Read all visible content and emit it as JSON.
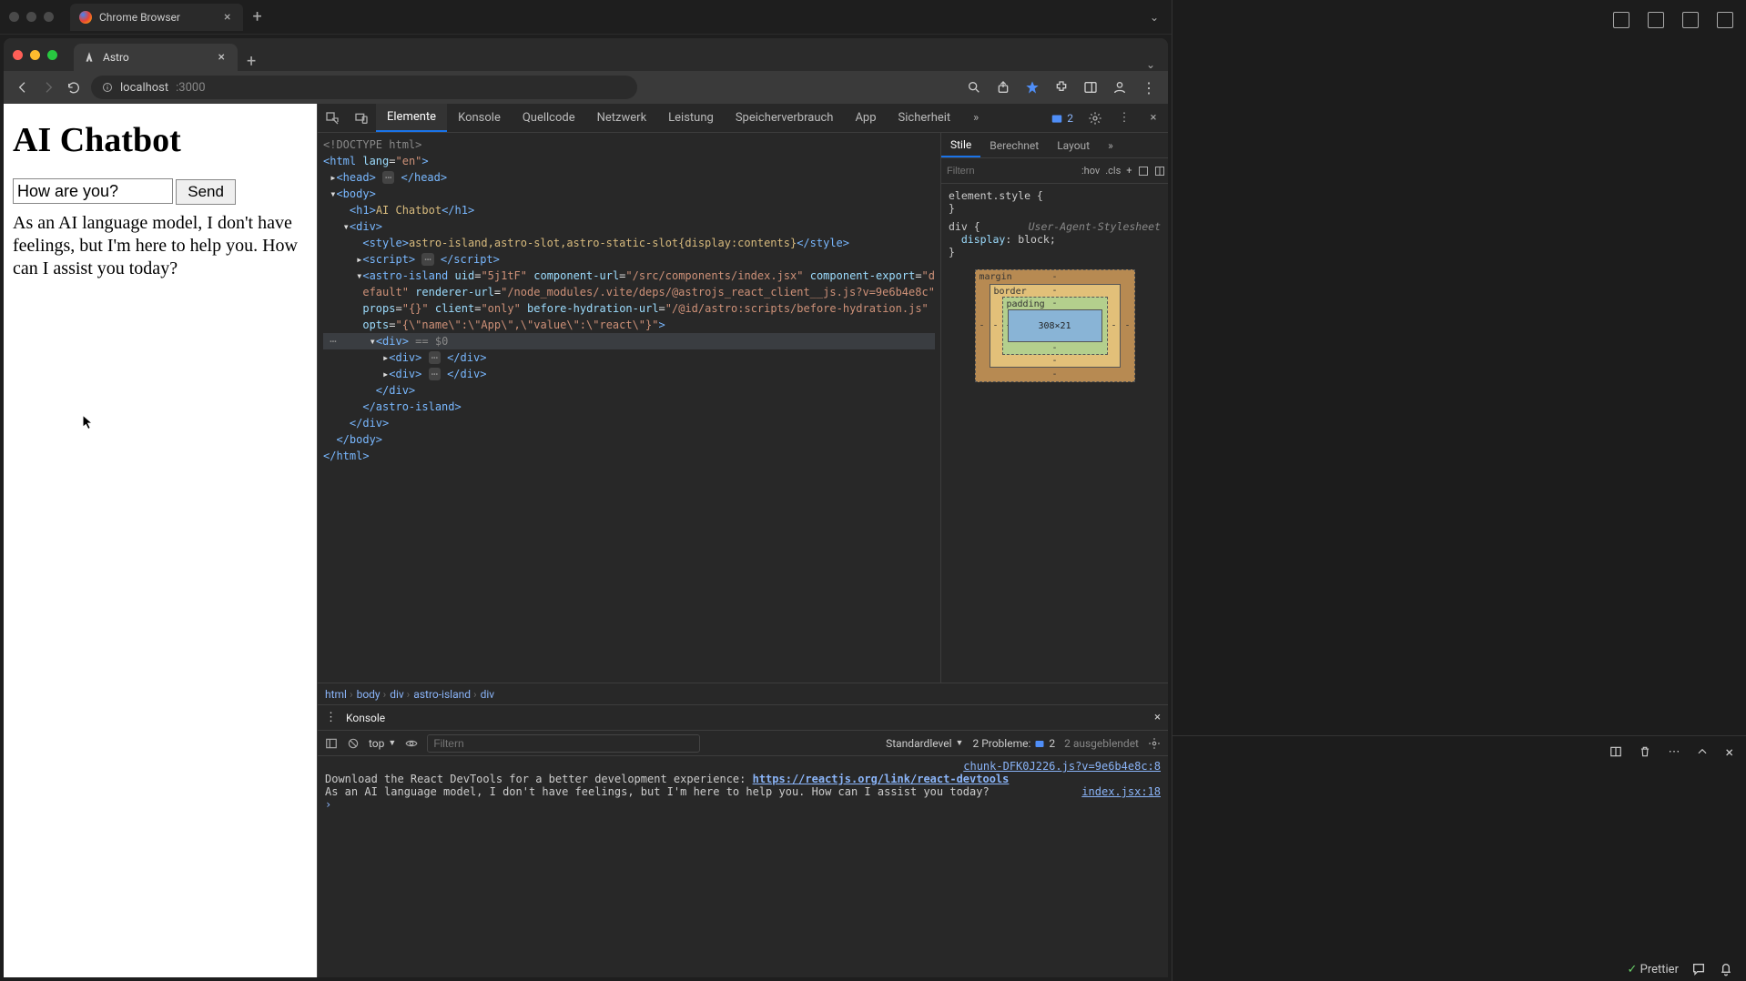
{
  "outer_window": {
    "tab_title": "Chrome Browser"
  },
  "browser": {
    "tab_title": "Astro",
    "address_host": "localhost",
    "address_rest": ":3000"
  },
  "page": {
    "heading": "AI Chatbot",
    "input_value": "How are you?",
    "send_label": "Send",
    "response_text": "As an AI language model, I don't have feelings, but I'm here to help you. How can I assist you today?"
  },
  "devtools": {
    "tabs": [
      "Elemente",
      "Konsole",
      "Quellcode",
      "Netzwerk",
      "Leistung",
      "Speicherverbrauch",
      "App",
      "Sicherheit"
    ],
    "active_tab": "Elemente",
    "issues_count": "2",
    "styles_tabs": [
      "Stile",
      "Berechnet",
      "Layout"
    ],
    "styles_active": "Stile",
    "filter_placeholder": "Filtern",
    "hov_label": ":hov",
    "cls_label": ".cls",
    "element_style_label": "element.style {",
    "close_brace": "}",
    "rule_selector": "div {",
    "rule_source": "User-Agent-Stylesheet",
    "rule_decl_prop": "display",
    "rule_decl_val": "block",
    "box": {
      "margin_label": "margin",
      "border_label": "border",
      "padding_label": "padding",
      "content_dims": "308×21"
    },
    "breadcrumb": [
      "html",
      "body",
      "div",
      "astro-island",
      "div"
    ]
  },
  "dom": {
    "l0": "<!DOCTYPE html>",
    "l1_open": "<html ",
    "l1_attr_n": "lang",
    "l1_attr_v": "\"en\"",
    "l1_close": ">",
    "l2": "<head>",
    "l2b": "</head>",
    "l3": "<body>",
    "l4": "<h1>",
    "l4t": "AI Chatbot",
    "l4c": "</h1>",
    "l5": "<div>",
    "l6": "<style>",
    "l6t": "astro-island,astro-slot,astro-static-slot{display:contents}",
    "l6c": "</style>",
    "l7": "<script>",
    "l7c": "</script>",
    "l8a": "<astro-island ",
    "l8_uid_n": "uid",
    "l8_uid_v": "\"5j1tF\"",
    "l8_cu_n": "component-url",
    "l8_cu_v": "\"/src/components/index.jsx\"",
    "l8_ce_n": "component-export",
    "l8_ce_v": "\"default\"",
    "l8_ru_n": "renderer-url",
    "l8_ru_v": "\"/node_modules/.vite/deps/@astrojs_react_client__js.js?v=9e6b4e8c\"",
    "l8_pr_n": "props",
    "l8_pr_v": "\"{}\"",
    "l8_cl_n": "client",
    "l8_cl_v": "\"only\"",
    "l8_bh_n": "before-hydration-url",
    "l8_bh_v": "\"/@id/astro:scripts/before-hydration.js\"",
    "l8_op_n": "opts",
    "l8_op_v": "\"{\\\"name\\\":\\\"App\\\",\\\"value\\\":\\\"react\\\"}\"",
    "l8_close": ">",
    "l9": "<div>",
    "l9b": " == $0",
    "l10": "<div>",
    "l10c": "</div>",
    "l11": "</div>",
    "l12": "</astro-island>",
    "l13": "</div>",
    "l14": "</body>",
    "l15": "</html>"
  },
  "console": {
    "tab_label": "Konsole",
    "context_label": "top",
    "filter_placeholder": "Filtern",
    "level_label": "Standardlevel",
    "problems_label": "2 Probleme:",
    "problems_badge": "2",
    "hidden_label": "2 ausgeblendet",
    "row1_src": "chunk-DFK0J226.js?v=9e6b4e8c:8",
    "row2_text": "Download the React DevTools for a better development experience: ",
    "row2_link": "https://reactjs.org/link/react-devtools",
    "row3_text": "As an AI language model, I don't have feelings, but I'm here to help you. How can I assist you today?",
    "row3_src": "index.jsx:18",
    "prompt": "›"
  },
  "statusbar": {
    "prettier": "Prettier"
  }
}
